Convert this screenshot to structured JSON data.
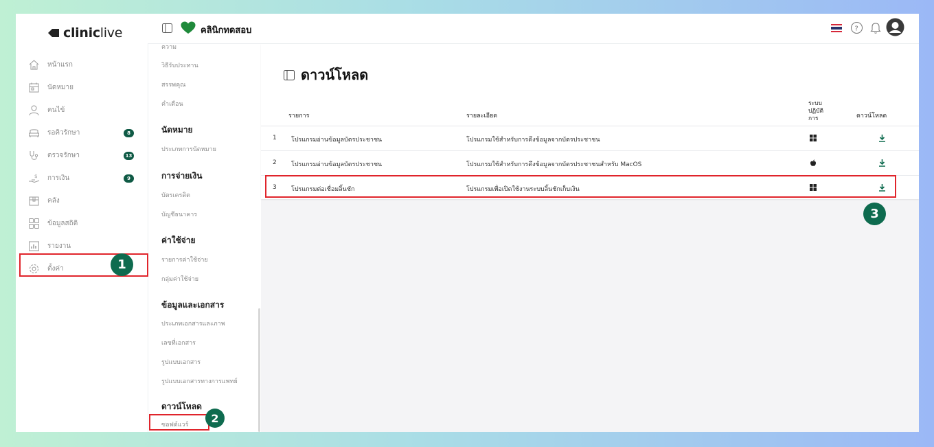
{
  "brand": {
    "logo_text_bold": "clinic",
    "logo_text_light": "live",
    "clinic_name": "คลินิกทดสอบ"
  },
  "sidebar": {
    "items": [
      {
        "label": "หน้าแรก",
        "icon": "home-icon"
      },
      {
        "label": "นัดหมาย",
        "icon": "calendar-icon"
      },
      {
        "label": "คนไข้",
        "icon": "user-icon"
      },
      {
        "label": "รอคิวรักษา",
        "icon": "sofa-icon",
        "badge": "8"
      },
      {
        "label": "ตรวจรักษา",
        "icon": "stethoscope-icon",
        "badge": "13"
      },
      {
        "label": "การเงิน",
        "icon": "money-hand-icon",
        "badge": "9"
      },
      {
        "label": "คลัง",
        "icon": "box-icon"
      },
      {
        "label": "ข้อมูลสถิติ",
        "icon": "grid-icon"
      },
      {
        "label": "รายงาน",
        "icon": "bar-chart-icon"
      },
      {
        "label": "ตั้งค่า",
        "icon": "gear-icon"
      }
    ]
  },
  "settings_menu": {
    "top_partial": "ความ",
    "items_a": [
      "วิธีรับประทาน",
      "สรรพคุณ",
      "คำเตือน"
    ],
    "appointment_heading": "นัดหมาย",
    "appointment_items": [
      "ประเภทการนัดหมาย"
    ],
    "payment_heading": "การจ่ายเงิน",
    "payment_items": [
      "บัตรเครดิต",
      "บัญชีธนาคาร"
    ],
    "expense_heading": "ค่าใช้จ่าย",
    "expense_items": [
      "รายการค่าใช้จ่าย",
      "กลุ่มค่าใช้จ่าย"
    ],
    "docs_heading": "ข้อมูลและเอกสาร",
    "docs_items": [
      "ประเภทเอกสารและภาพ",
      "เลขที่เอกสาร",
      "รูปแบบเอกสาร",
      "รูปแบบเอกสารทางการแพทย์"
    ],
    "download_heading": "ดาวน์โหลด",
    "download_items": [
      "ซอฟต์แวร์"
    ]
  },
  "main": {
    "title": "ดาวน์โหลด",
    "columns": {
      "item": "รายการ",
      "detail": "รายละเอียด",
      "os": "ระบบ\nปฏิบัติ\nการ",
      "download": "ดาวน์โหลด"
    },
    "rows": [
      {
        "no": "1",
        "name": "โปรแกรมอ่านข้อมูลบัตรประชาชน",
        "detail": "โปรแกรมใช้สำหรับการดึงข้อมูลจากบัตรประชาชน",
        "os": "windows-icon"
      },
      {
        "no": "2",
        "name": "โปรแกรมอ่านข้อมูลบัตรประชาชน",
        "detail": "โปรแกรมใช้สำหรับการดึงข้อมูลจากบัตรประชาชนสำหรับ MacOS",
        "os": "apple-icon"
      },
      {
        "no": "3",
        "name": "โปรแกรมต่อเชื่อมลิ้นชัก",
        "detail": "โปรแกรมเพื่อเปิดใช้งานระบบลิ้นชักเก็บเงิน",
        "os": "windows-icon"
      }
    ]
  },
  "steps": [
    "1",
    "2",
    "3"
  ],
  "colors": {
    "accent": "#0e6b4f",
    "highlight": "#e0242b",
    "logo_green": "#1f8a3b"
  }
}
